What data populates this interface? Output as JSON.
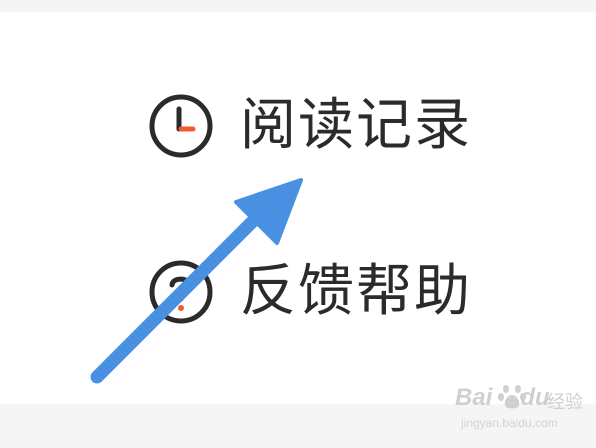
{
  "menu": {
    "items": [
      {
        "label": "阅读记录",
        "icon": "clock-icon"
      },
      {
        "label": "反馈帮助",
        "icon": "help-circle-icon"
      }
    ]
  },
  "annotation": {
    "icon": "pointer-arrow-icon",
    "color": "#4a90e2"
  },
  "watermark": {
    "logo_text": "Bai",
    "logo_text_tail": "du",
    "brand_cn": "经验",
    "url": "jingyan.baidu.com"
  },
  "colors": {
    "text": "#2b2b2b",
    "icon_stroke": "#2b2b2b",
    "accent": "#f25a29",
    "arrow": "#4a90e2",
    "background": "#ffffff"
  }
}
